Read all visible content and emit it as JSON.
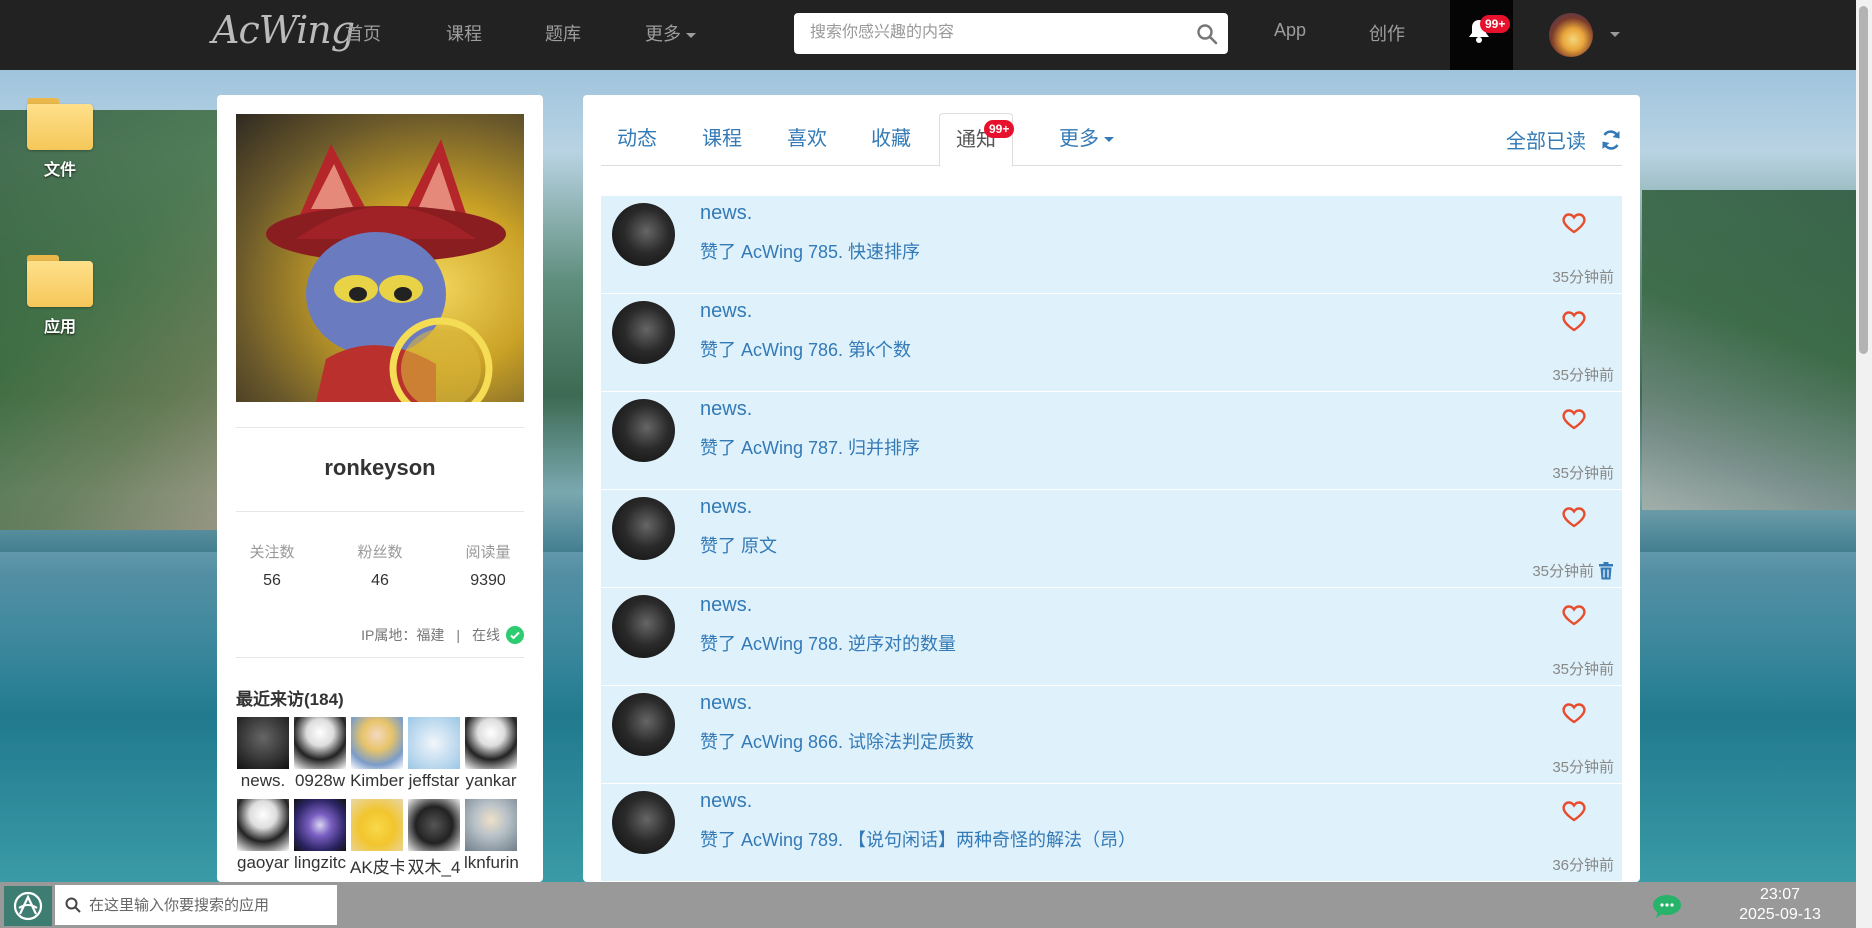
{
  "nav": {
    "logo": "AcWing",
    "home": "首页",
    "courses": "课程",
    "problems": "题库",
    "more": "更多",
    "search_placeholder": "搜索你感兴趣的内容",
    "app": "App",
    "create": "创作",
    "bell_badge": "99+"
  },
  "desktop": [
    {
      "label": "文件"
    },
    {
      "label": "应用"
    }
  ],
  "profile": {
    "username": "ronkeyson",
    "stats": [
      {
        "label": "关注数",
        "value": "56"
      },
      {
        "label": "粉丝数",
        "value": "46"
      },
      {
        "label": "阅读量",
        "value": "9390"
      }
    ],
    "ip_label": "IP属地：福建",
    "separator": "|",
    "online": "在线",
    "visitors_title": "最近来访(184)",
    "visitors": [
      {
        "name": "news."
      },
      {
        "name": "0928w"
      },
      {
        "name": "Kimber"
      },
      {
        "name": "jeffstar"
      },
      {
        "name": "yankar"
      },
      {
        "name": "gaoyar"
      },
      {
        "name": "lingzitc"
      },
      {
        "name": "AK皮卡"
      },
      {
        "name": "双木_4"
      },
      {
        "name": "lknfurin"
      }
    ]
  },
  "tabs": [
    {
      "label": "动态"
    },
    {
      "label": "课程"
    },
    {
      "label": "喜欢"
    },
    {
      "label": "收藏"
    },
    {
      "label": "通知",
      "badge": "99+"
    },
    {
      "label": "更多"
    }
  ],
  "mark_all_read": "全部已读",
  "notifications": [
    {
      "user": "news.",
      "text": "赞了 AcWing 785. 快速排序",
      "time": "35分钟前"
    },
    {
      "user": "news.",
      "text": "赞了 AcWing 786. 第k个数",
      "time": "35分钟前"
    },
    {
      "user": "news.",
      "text": "赞了 AcWing 787. 归并排序",
      "time": "35分钟前"
    },
    {
      "user": "news.",
      "text": "赞了 原文",
      "time": "35分钟前"
    },
    {
      "user": "news.",
      "text": "赞了 AcWing 788. 逆序对的数量",
      "time": "35分钟前"
    },
    {
      "user": "news.",
      "text": "赞了 AcWing 866. 试除法判定质数",
      "time": "35分钟前"
    },
    {
      "user": "news.",
      "text": "赞了 AcWing 789. 【说句闲话】两种奇怪的解法（昂）",
      "time": "36分钟前"
    }
  ],
  "taskbar": {
    "search_placeholder": "在这里输入你要搜索的应用",
    "time": "23:07",
    "date": "2025-09-13"
  }
}
